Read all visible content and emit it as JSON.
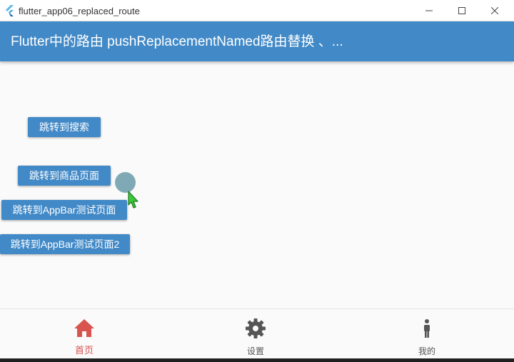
{
  "window": {
    "title": "flutter_app06_replaced_route",
    "minimize_symbol": "—",
    "maximize_symbol": "☐",
    "close_symbol": "✕"
  },
  "appbar": {
    "title": "Flutter中的路由 pushReplacementNamed路由替换 、..."
  },
  "buttons": {
    "search": "跳转到搜索",
    "product": "跳转到商品页面",
    "appbar_test": "跳转到AppBar测试页面",
    "appbar_test2": "跳转到AppBar测试页面2"
  },
  "bottom_nav": {
    "items": [
      {
        "label": "首页",
        "icon": "home-icon",
        "active": true
      },
      {
        "label": "设置",
        "icon": "gear-icon",
        "active": false
      },
      {
        "label": "我的",
        "icon": "person-icon",
        "active": false
      }
    ]
  },
  "colors": {
    "primary": "#4189c7",
    "active_nav": "#d9534f",
    "inactive_nav": "#555555",
    "touch_indicator": "#7faab5"
  }
}
